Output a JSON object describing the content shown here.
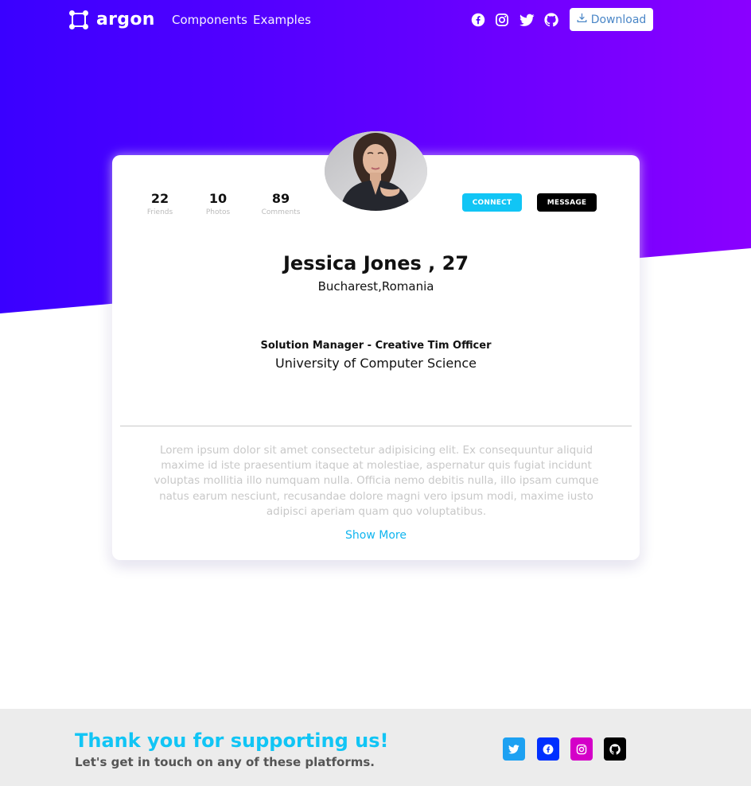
{
  "navbar": {
    "brand": "argon",
    "links": [
      "Components",
      "Examples"
    ],
    "social_icons": [
      "facebook-icon",
      "instagram-icon",
      "twitter-icon",
      "github-icon"
    ],
    "download_label": "Download"
  },
  "profile": {
    "stats": [
      {
        "value": "22",
        "label": "Friends"
      },
      {
        "value": "10",
        "label": "Photos"
      },
      {
        "value": "89",
        "label": "Comments"
      }
    ],
    "connect_label": "CONNECT",
    "message_label": "MESSAGE",
    "name": "Jessica Jones , 27",
    "location": "Bucharest,Romania",
    "job": "Solution Manager - Creative Tim Officer",
    "school": "University of Computer Science",
    "bio": "Lorem ipsum dolor sit amet consectetur adipisicing elit. Ex consequuntur aliquid maxime id iste praesentium itaque at molestiae, aspernatur quis fugiat incidunt voluptas mollitia illo numquam nulla. Officia nemo debitis nulla, illo ipsam cumque natus earum nesciunt, recusandae dolore magni vero ipsum modi, maxime iusto adipisci aperiam quam quo voluptatibus.",
    "show_more": "Show More"
  },
  "footer": {
    "title": "Thank you for supporting us!",
    "subtitle": "Let's get in touch on any of these platforms.",
    "social": [
      {
        "icon": "twitter-icon",
        "color": "#1da1f2"
      },
      {
        "icon": "facebook-icon",
        "color": "#0030ff"
      },
      {
        "icon": "instagram-icon",
        "color": "#d400c8"
      },
      {
        "icon": "github-icon",
        "color": "#000000"
      }
    ]
  },
  "colors": {
    "hero_start": "#3a00ff",
    "hero_end": "#8a00ff",
    "accent": "#11c5f5"
  }
}
